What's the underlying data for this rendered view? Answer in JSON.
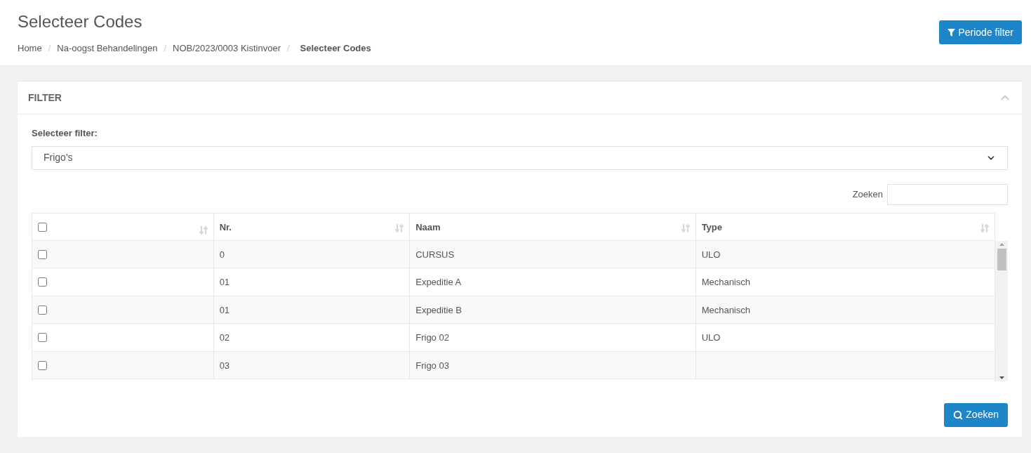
{
  "page_title": "Selecteer Codes",
  "breadcrumb": [
    {
      "label": "Home",
      "current": false
    },
    {
      "separator": "/",
      "label": "Na-oogst Behandelingen",
      "current": false
    },
    {
      "separator": "/",
      "label": "NOB/2023/0003 Kistinvoer",
      "current": false
    },
    {
      "separator": "/",
      "label": "Selecteer Codes",
      "current": true
    }
  ],
  "period_button": "Periode filter",
  "panel": {
    "title": "FILTER",
    "expanded": true
  },
  "filter_label": "Selecteer filter:",
  "filter_value": "Frigo's",
  "search_label": "Zoeken",
  "table": {
    "select_all_checked": false,
    "columns": [
      "Nr.",
      "Naam",
      "Type"
    ],
    "rows": [
      {
        "checked": false,
        "cells": [
          "0",
          "CURSUS",
          "ULO"
        ]
      },
      {
        "checked": false,
        "cells": [
          "01",
          "Expeditie A",
          "Mechanisch"
        ]
      },
      {
        "checked": false,
        "cells": [
          "01",
          "Expeditie B",
          "Mechanisch"
        ]
      },
      {
        "checked": false,
        "cells": [
          "02",
          "Frigo 02",
          "ULO"
        ]
      },
      {
        "checked": false,
        "cells": [
          "03",
          "Frigo 03",
          ""
        ]
      }
    ]
  },
  "search_button": "Zoeken"
}
